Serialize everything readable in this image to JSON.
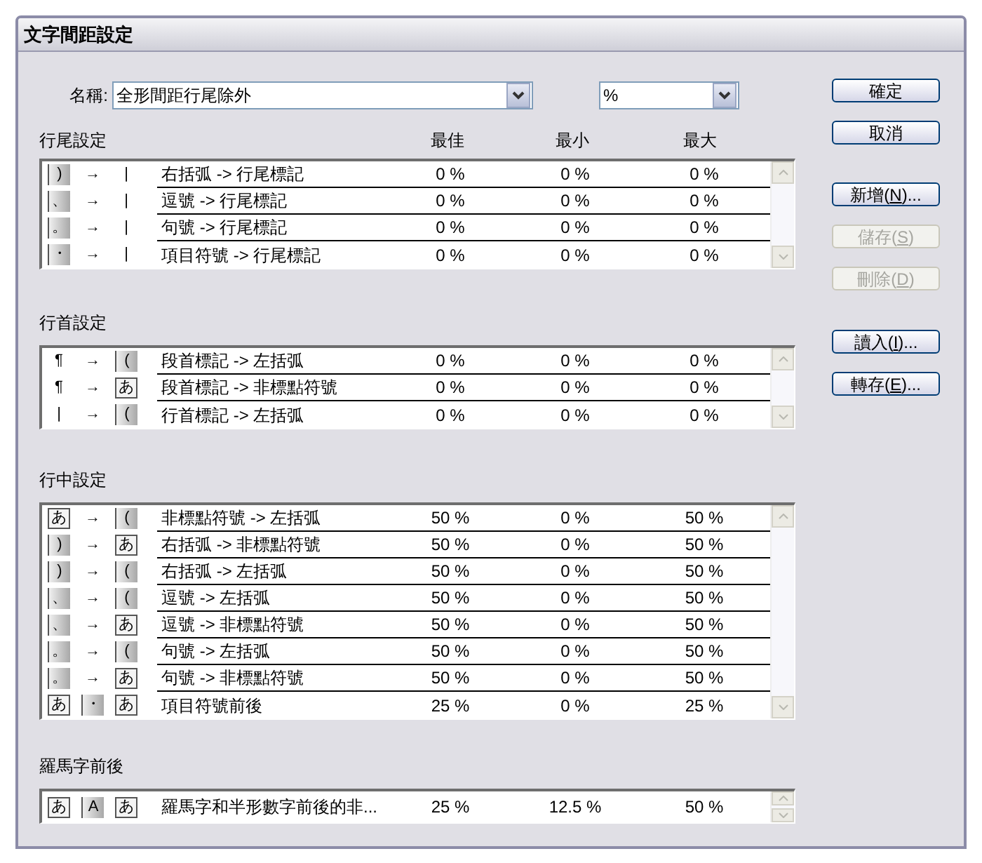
{
  "window": {
    "title": "文字間距設定"
  },
  "name_field": {
    "label": "名稱:",
    "value": "全形間距行尾除外"
  },
  "unit_field": {
    "value": "%"
  },
  "columns": [
    "最佳",
    "最小",
    "最大"
  ],
  "sections": [
    {
      "title": "行尾設定",
      "rows": [
        {
          "symbols": [
            {
              "kind": "shaded",
              "char": ")"
            },
            {
              "kind": "plain",
              "char": "→"
            },
            {
              "kind": "plain",
              "char": "|"
            }
          ],
          "label": "右括弧 -> 行尾標記",
          "best": "0 %",
          "min": "0 %",
          "max": "0 %"
        },
        {
          "symbols": [
            {
              "kind": "shaded",
              "char": "、"
            },
            {
              "kind": "plain",
              "char": "→"
            },
            {
              "kind": "plain",
              "char": "|"
            }
          ],
          "label": "逗號 -> 行尾標記",
          "best": "0 %",
          "min": "0 %",
          "max": "0 %"
        },
        {
          "symbols": [
            {
              "kind": "shaded",
              "char": "。"
            },
            {
              "kind": "plain",
              "char": "→"
            },
            {
              "kind": "plain",
              "char": "|"
            }
          ],
          "label": "句號 -> 行尾標記",
          "best": "0 %",
          "min": "0 %",
          "max": "0 %"
        },
        {
          "symbols": [
            {
              "kind": "shaded",
              "char": "・"
            },
            {
              "kind": "plain",
              "char": "→"
            },
            {
              "kind": "plain",
              "char": "|"
            }
          ],
          "label": "項目符號 -> 行尾標記",
          "best": "0 %",
          "min": "0 %",
          "max": "0 %"
        }
      ]
    },
    {
      "title": "行首設定",
      "rows": [
        {
          "symbols": [
            {
              "kind": "plain",
              "char": "¶"
            },
            {
              "kind": "plain",
              "char": "→"
            },
            {
              "kind": "shaded",
              "char": "("
            }
          ],
          "label": "段首標記 -> 左括弧",
          "best": "0 %",
          "min": "0 %",
          "max": "0 %"
        },
        {
          "symbols": [
            {
              "kind": "plain",
              "char": "¶"
            },
            {
              "kind": "plain",
              "char": "→"
            },
            {
              "kind": "boxed",
              "char": "あ"
            }
          ],
          "label": "段首標記 -> 非標點符號",
          "best": "0 %",
          "min": "0 %",
          "max": "0 %"
        },
        {
          "symbols": [
            {
              "kind": "plain",
              "char": "|"
            },
            {
              "kind": "plain",
              "char": "→"
            },
            {
              "kind": "shaded",
              "char": "("
            }
          ],
          "label": "行首標記 -> 左括弧",
          "best": "0 %",
          "min": "0 %",
          "max": "0 %"
        }
      ]
    },
    {
      "title": "行中設定",
      "rows": [
        {
          "symbols": [
            {
              "kind": "boxed",
              "char": "あ"
            },
            {
              "kind": "plain",
              "char": "→"
            },
            {
              "kind": "shaded",
              "char": "("
            }
          ],
          "label": "非標點符號 -> 左括弧",
          "best": "50 %",
          "min": "0 %",
          "max": "50 %"
        },
        {
          "symbols": [
            {
              "kind": "shaded",
              "char": ")"
            },
            {
              "kind": "plain",
              "char": "→"
            },
            {
              "kind": "boxed",
              "char": "あ"
            }
          ],
          "label": "右括弧 -> 非標點符號",
          "best": "50 %",
          "min": "0 %",
          "max": "50 %"
        },
        {
          "symbols": [
            {
              "kind": "shaded",
              "char": ")"
            },
            {
              "kind": "plain",
              "char": "→"
            },
            {
              "kind": "shaded",
              "char": "("
            }
          ],
          "label": "右括弧 -> 左括弧",
          "best": "50 %",
          "min": "0 %",
          "max": "50 %"
        },
        {
          "symbols": [
            {
              "kind": "shaded",
              "char": "、"
            },
            {
              "kind": "plain",
              "char": "→"
            },
            {
              "kind": "shaded",
              "char": "("
            }
          ],
          "label": "逗號 -> 左括弧",
          "best": "50 %",
          "min": "0 %",
          "max": "50 %"
        },
        {
          "symbols": [
            {
              "kind": "shaded",
              "char": "、"
            },
            {
              "kind": "plain",
              "char": "→"
            },
            {
              "kind": "boxed",
              "char": "あ"
            }
          ],
          "label": "逗號 -> 非標點符號",
          "best": "50 %",
          "min": "0 %",
          "max": "50 %"
        },
        {
          "symbols": [
            {
              "kind": "shaded",
              "char": "。"
            },
            {
              "kind": "plain",
              "char": "→"
            },
            {
              "kind": "shaded",
              "char": "("
            }
          ],
          "label": "句號 -> 左括弧",
          "best": "50 %",
          "min": "0 %",
          "max": "50 %"
        },
        {
          "symbols": [
            {
              "kind": "shaded",
              "char": "。"
            },
            {
              "kind": "plain",
              "char": "→"
            },
            {
              "kind": "boxed",
              "char": "あ"
            }
          ],
          "label": "句號 -> 非標點符號",
          "best": "50 %",
          "min": "0 %",
          "max": "50 %"
        },
        {
          "symbols": [
            {
              "kind": "boxed",
              "char": "あ"
            },
            {
              "kind": "shaded",
              "char": "・"
            },
            {
              "kind": "boxed",
              "char": "あ"
            }
          ],
          "label": "項目符號前後",
          "best": "25 %",
          "min": "0 %",
          "max": "25 %"
        }
      ]
    },
    {
      "title": "羅馬字前後",
      "rows": [
        {
          "symbols": [
            {
              "kind": "boxed",
              "char": "あ"
            },
            {
              "kind": "shaded",
              "char": "A"
            },
            {
              "kind": "boxed",
              "char": "あ"
            }
          ],
          "label": "羅馬字和半形數字前後的非...",
          "best": "25 %",
          "min": "12.5 %",
          "max": "50 %"
        }
      ]
    }
  ],
  "buttons": [
    {
      "label": [
        "確定"
      ],
      "disabled": false
    },
    {
      "label": [
        "取消"
      ],
      "disabled": false
    },
    {
      "label": [
        "新增(",
        "N",
        ")..."
      ],
      "disabled": false
    },
    {
      "label": [
        "儲存(",
        "S",
        ")"
      ],
      "disabled": true
    },
    {
      "label": [
        "刪除(",
        "D",
        ")"
      ],
      "disabled": true
    },
    {
      "label": [
        "讀入(",
        "I",
        ")..."
      ],
      "disabled": false
    },
    {
      "label": [
        "轉存(",
        "E",
        ")..."
      ],
      "disabled": false
    }
  ]
}
